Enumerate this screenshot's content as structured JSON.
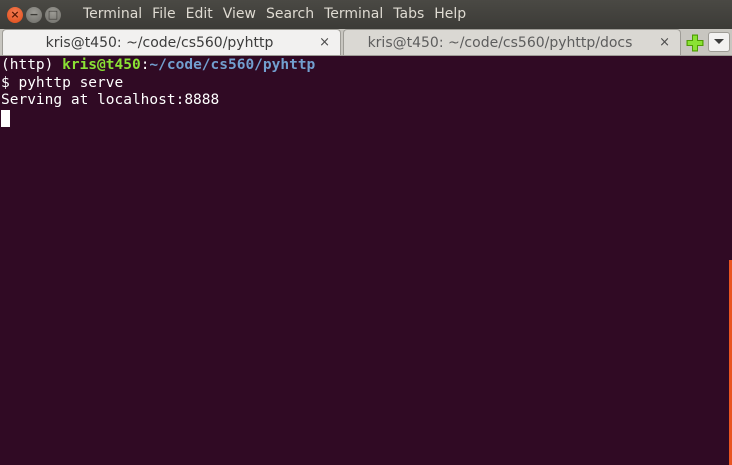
{
  "window": {
    "buttons": {
      "close": "×",
      "minimize": "−",
      "maximize": "□"
    }
  },
  "menu": {
    "items": [
      "Terminal",
      "File",
      "Edit",
      "View",
      "Search",
      "Terminal",
      "Tabs",
      "Help"
    ]
  },
  "tabs": [
    {
      "label": "kris@t450: ~/code/cs560/pyhttp",
      "close": "×",
      "active": true
    },
    {
      "label": "kris@t450: ~/code/cs560/pyhttp/docs",
      "close": "×",
      "active": false
    }
  ],
  "tabbar_icons": {
    "new_tab": "plus-icon",
    "menu": "chevron-down-icon"
  },
  "terminal": {
    "prompt_prefix": "(http) ",
    "prompt_user": "kris@t450",
    "prompt_sep": ":",
    "prompt_path": "~/code/cs560/pyhttp",
    "command_line": "$ pyhttp serve",
    "output_line": "Serving at localhost:8888"
  },
  "colors": {
    "background": "#300a24",
    "prompt_user": "#8ae234",
    "prompt_path": "#729fcf",
    "scrollbar": "#e95420"
  }
}
